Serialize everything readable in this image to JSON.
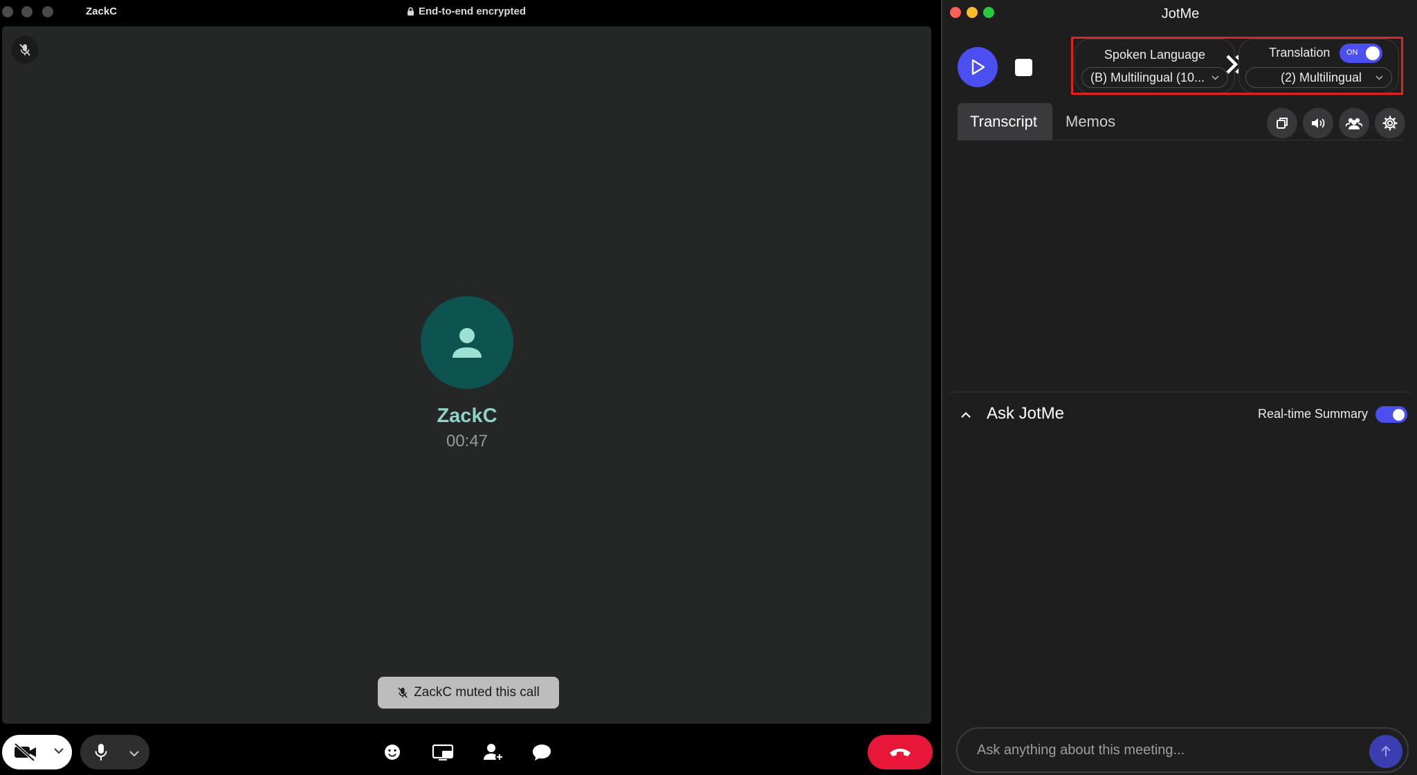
{
  "call_window": {
    "title": "ZackC",
    "encryption": "End-to-end encrypted",
    "contact": {
      "name": "ZackC",
      "duration": "00:47"
    },
    "toast": "ZackC muted this call",
    "icons": [
      "mic-off-icon",
      "person-icon",
      "lock-icon",
      "video-off-icon",
      "mic-icon",
      "emoji-icon",
      "screen-share-icon",
      "add-person-icon",
      "chat-icon",
      "hang-up-icon"
    ],
    "colors": {
      "end_call": "#e8173a",
      "avatar_bg": "#0d5350",
      "name": "#8fd3c6"
    }
  },
  "jotme": {
    "title": "JotMe",
    "spoken_language": {
      "label": "Spoken Language",
      "value": "(B) Multilingual (10..."
    },
    "translation": {
      "label": "Translation",
      "toggle_text": "ON",
      "enabled": true,
      "value": "(2) Multilingual"
    },
    "tabs": [
      {
        "label": "Transcript",
        "active": true
      },
      {
        "label": "Memos",
        "active": false
      }
    ],
    "ask": {
      "title": "Ask JotMe",
      "realtime_summary_label": "Real-time Summary",
      "realtime_summary_on": true,
      "input_placeholder": "Ask anything about this meeting..."
    },
    "colors": {
      "accent": "#4b4ff0",
      "highlight": "#e0231e"
    }
  }
}
